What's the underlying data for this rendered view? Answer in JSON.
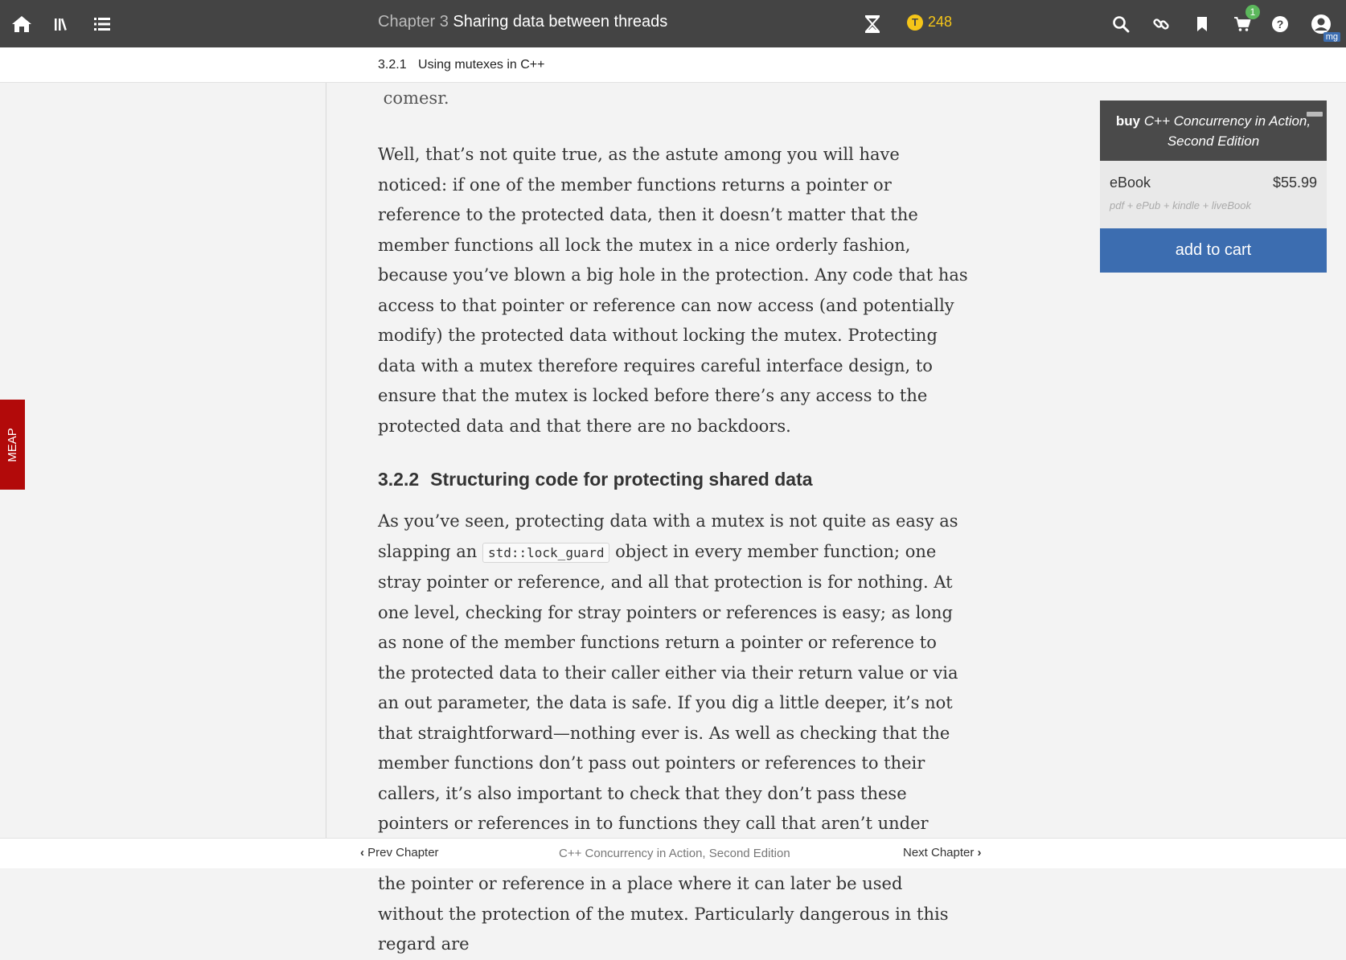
{
  "topbar": {
    "icons": [
      "home-icon",
      "library-icon",
      "toc-icon",
      "hourglass-icon",
      "search-icon",
      "link-icon",
      "bookmark-icon",
      "cart-icon",
      "help-icon",
      "user-icon"
    ],
    "chapter_num": "Chapter 3",
    "chapter_name": "Sharing data between threads",
    "tokens": "248",
    "token_symbol": "T",
    "cart_count": "1",
    "user_initials": "mg"
  },
  "subheader": {
    "section_num": "3.2.1",
    "section_title": "Using mutexes in C++"
  },
  "content": {
    "ghost_line": " comesr.",
    "para1": "Well, that’s not quite true, as the astute among you will have noticed: if one of the member functions returns a pointer or reference to the protected data, then it doesn’t matter that the member functions all lock the mutex in a nice orderly fashion, because you’ve blown a big hole in the protection. Any code that has access to that pointer or reference can now access (and potentially modify) the protected data without locking the mutex. Protecting data with a mutex therefore requires careful interface design, to ensure that the mutex is locked before there’s any access to the protected data and that there are no backdoors.",
    "heading_num": "3.2.2",
    "heading_title": "Structuring code for protecting shared data",
    "para2_start": "As you’ve seen, protecting data with a mutex is not quite as easy as slapping an ",
    "para2_code": "std::lock_guard",
    "para2_end": " object in every member function; one stray pointer or reference, and all that protection is for nothing. At one level, checking for stray pointers or references is easy; as long as none of the member functions return a pointer or reference to the protected data to their caller either via their return value or via an out parameter, the data is safe. If you dig a little deeper, it’s not that straightforward—nothing ever is. As well as checking that the member functions don’t pass out pointers or references to their callers, it’s also important to check that they don’t pass these pointers or references in to functions they call that aren’t under your control. This is just as dangerous: those functions might store the pointer or reference in a place where it can later be used without the protection of the mutex. Particularly dangerous in this regard are"
  },
  "sidebar": {
    "meap_label": "MEAP"
  },
  "buybox": {
    "buy_word": "buy",
    "book_title": "C++ Concurrency in Action, Second Edition",
    "format": "eBook",
    "price": "$55.99",
    "includes": "pdf + ePub + kindle + liveBook",
    "add_to_cart": "add to cart"
  },
  "footer": {
    "prev": "Prev Chapter",
    "book_title": "C++ Concurrency in Action, Second Edition",
    "next": "Next Chapter"
  },
  "colors": {
    "topbar": "#444444",
    "accent_blue": "#3c6db0",
    "meap_red": "#b20a0a",
    "token_gold": "#f5c518",
    "badge_green": "#5cb85c"
  }
}
